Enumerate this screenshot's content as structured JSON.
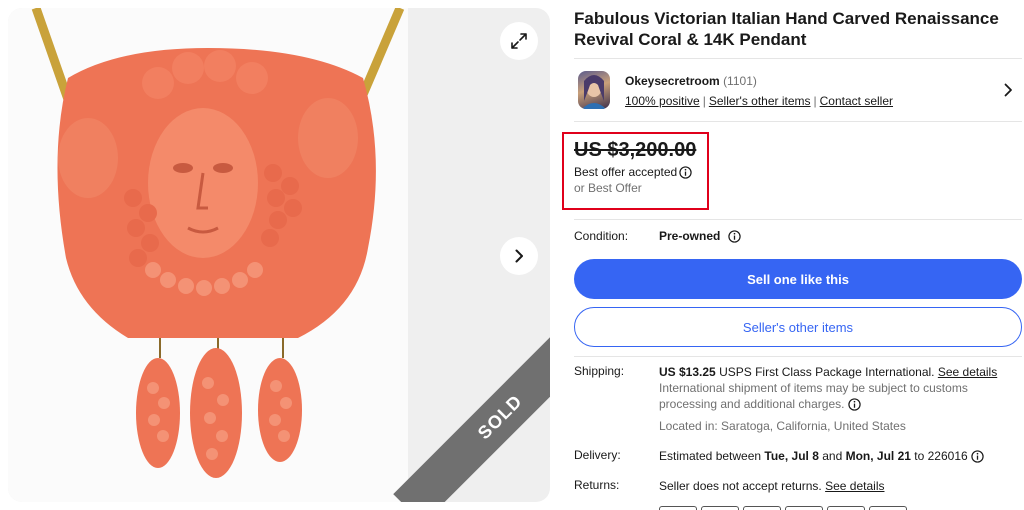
{
  "listing": {
    "title": "Fabulous Victorian Italian Hand Carved Renaissance Revival Coral & 14K Pendant",
    "status_ribbon": "SOLD"
  },
  "seller": {
    "name": "Okeysecretroom",
    "feedback_count": "(1101)",
    "positive": "100% positive",
    "other_items_link": "Seller's other items",
    "contact_link": "Contact seller"
  },
  "price": {
    "amount": "US $3,200.00",
    "offer_status": "Best offer accepted",
    "or_best_offer": "or Best Offer"
  },
  "condition": {
    "label": "Condition:",
    "value": "Pre-owned"
  },
  "actions": {
    "sell_one": "Sell one like this",
    "sellers_other_items": "Seller's other items"
  },
  "shipping": {
    "label": "Shipping:",
    "cost": "US $13.25",
    "service": "USPS First Class Package International.",
    "see_details": "See details",
    "note": "International shipment of items may be subject to customs processing and additional charges.",
    "location": "Located in: Saratoga, California, United States"
  },
  "delivery": {
    "label": "Delivery:",
    "prefix": "Estimated between",
    "start": "Tue, Jul 8",
    "and": "and",
    "end": "Mon, Jul 21",
    "to_zip": "to 226016"
  },
  "returns": {
    "label": "Returns:",
    "text": "Seller does not accept returns.",
    "see_details": "See details"
  },
  "colors": {
    "accent_blue": "#3665f3",
    "highlight_red": "#e0001b",
    "coral": "#f0765a"
  }
}
